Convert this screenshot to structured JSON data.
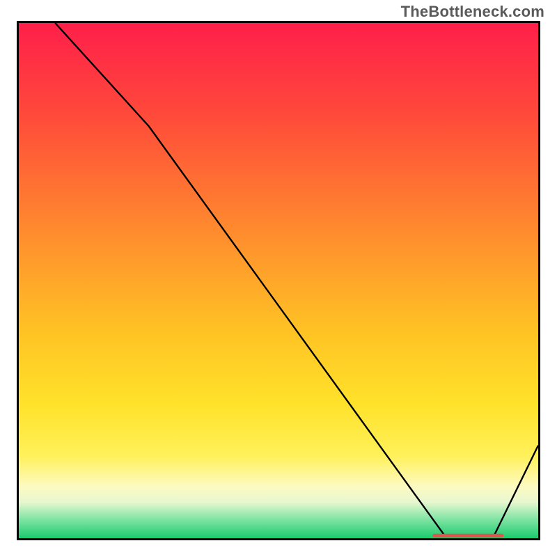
{
  "watermark": "TheBottleneck.com",
  "chart_data": {
    "type": "line",
    "title": "",
    "xlabel": "",
    "ylabel": "",
    "xlim": [
      0,
      100
    ],
    "ylim": [
      0,
      100
    ],
    "grid": false,
    "legend": false,
    "series": [
      {
        "name": "curve",
        "x": [
          7,
          25,
          82,
          91.5,
          100
        ],
        "y": [
          100,
          80,
          0.5,
          0.5,
          18
        ]
      }
    ],
    "optimal_marker": {
      "x_start": 80,
      "x_end": 93,
      "y": 0.5
    },
    "background_gradient": {
      "top": "#ff1f4a",
      "mid": "#ffe22a",
      "bottom": "#1acb6d"
    }
  }
}
